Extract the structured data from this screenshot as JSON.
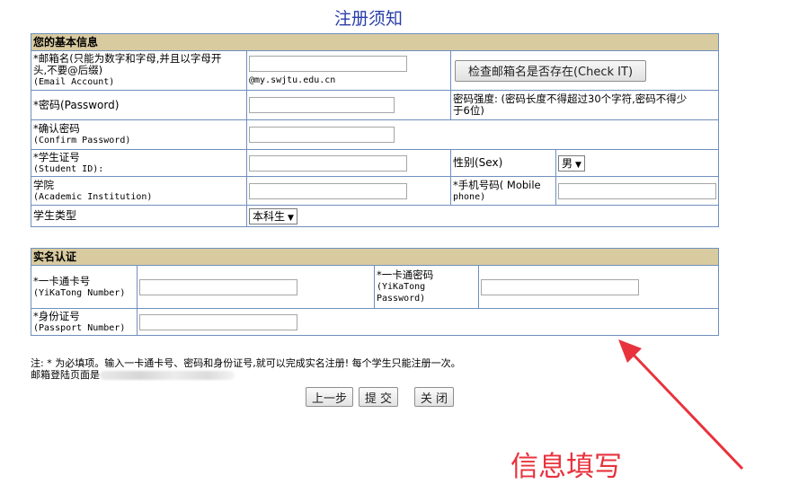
{
  "page": {
    "title": "注册须知"
  },
  "basic": {
    "header": "您的基本信息",
    "email": {
      "label_line1": "*邮箱名(只能为数字和字母,并且以字母开",
      "label_line2": "头,不要@后缀)",
      "label_en": "(Email Account)",
      "suffix": "@my.swjtu.edu.cn",
      "value": "",
      "check_button": "检查邮箱名是否存在(Check IT)"
    },
    "password": {
      "label": "*密码(Password)",
      "value": "",
      "strength_line1": "密码强度: (密码长度不得超过30个字符,密码不得少",
      "strength_line2": "于6位)"
    },
    "confirm": {
      "label": "*确认密码",
      "label_en": "(Confirm Password)",
      "value": ""
    },
    "student_id": {
      "label": "*学生证号",
      "label_en": "(Student ID):",
      "value": ""
    },
    "gender": {
      "label": "性别(Sex)",
      "selected": "男"
    },
    "institution": {
      "label": "学院",
      "label_en": "(Academic Institution)",
      "value": ""
    },
    "mobile": {
      "label_line1": "*手机号码( Mobile",
      "label_line2": "phone)",
      "value": ""
    },
    "student_type": {
      "label": "学生类型",
      "selected": "本科生"
    }
  },
  "realname": {
    "header": "实名认证",
    "card_number": {
      "label": "*一卡通卡号",
      "label_en": "(YiKaTong Number)",
      "value": ""
    },
    "card_password": {
      "label": "*一卡通密码",
      "label_en1": "(YiKaTong",
      "label_en2": "Password)",
      "value": ""
    },
    "passport": {
      "label": "*身份证号",
      "label_en": "(Passport Number)",
      "value": ""
    }
  },
  "notes": {
    "line1": "注: * 为必填项。输入一卡通卡号、密码和身份证号,就可以完成实名注册! 每个学生只能注册一次。",
    "line2": "邮箱登陆页面是"
  },
  "buttons": {
    "prev": "上一步",
    "submit": "提 交",
    "close": "关 闭"
  },
  "annotation": {
    "text": "信息填写",
    "color": "#e8323c"
  },
  "colors": {
    "title": "#2a3fa8",
    "header_bg": "#d9cba0",
    "border": "#6f8fbd"
  }
}
